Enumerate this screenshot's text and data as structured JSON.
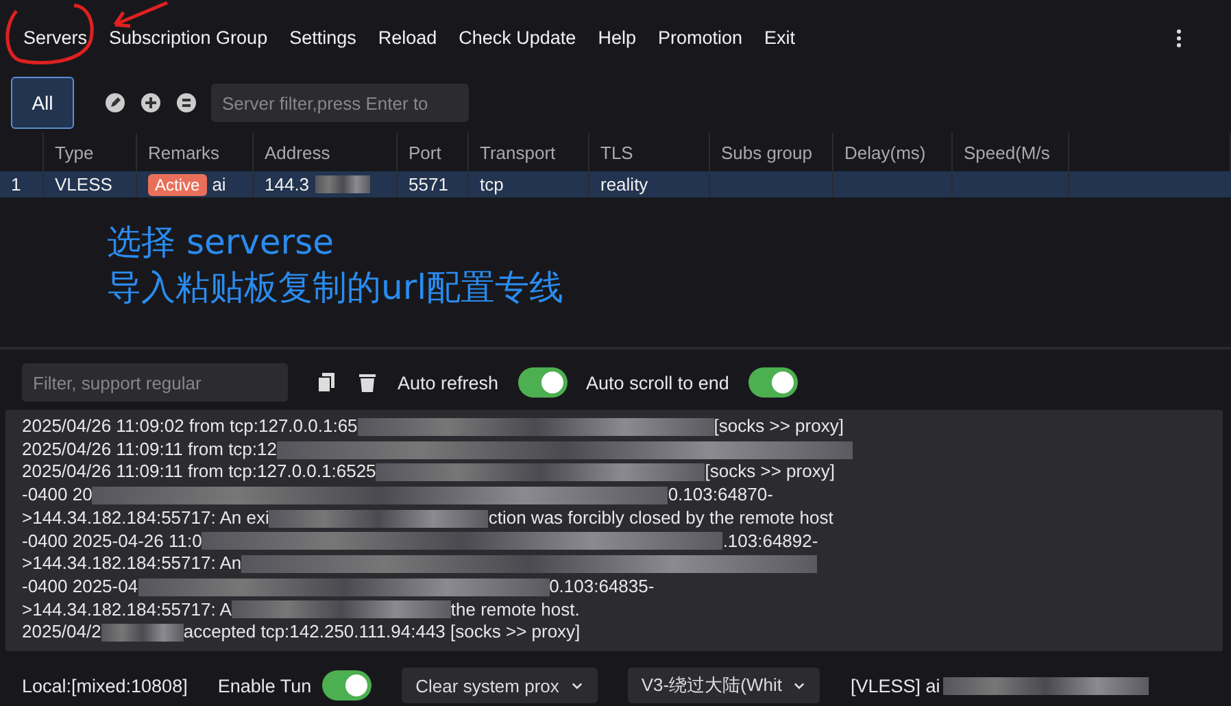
{
  "menu": [
    "Servers",
    "Subscription Group",
    "Settings",
    "Reload",
    "Check Update",
    "Help",
    "Promotion",
    "Exit"
  ],
  "group_tabs": [
    {
      "label": "All",
      "selected": true
    }
  ],
  "server_filter": {
    "placeholder": "Server filter,press Enter to "
  },
  "table": {
    "columns": [
      "",
      "Type",
      "Remarks",
      "Address",
      "Port",
      "Transport",
      "TLS",
      "Subs group",
      "Delay(ms)",
      "Speed(M/s"
    ],
    "rows": [
      {
        "selected": true,
        "cells": [
          "1",
          "VLESS",
          "ai",
          "144.3",
          "5571",
          "tcp",
          "reality",
          "",
          "",
          ""
        ],
        "badge": "Active"
      }
    ]
  },
  "log_filter": {
    "placeholder": "Filter, support regular"
  },
  "toggles": [
    {
      "label": "Auto refresh",
      "on": true
    },
    {
      "label": "Auto scroll to end",
      "on": true
    }
  ],
  "log_lines": [
    {
      "start": "2025/04/26 11:09:02 from tcp:127.0.0.1:65",
      "end": "[socks >> proxy]"
    },
    {
      "start": "2025/04/26 11:09:11 from tcp:12"
    },
    {
      "start": "2025/04/26 11:09:11 from tcp:127.0.0.1:6525",
      "end": "[socks >> proxy]"
    },
    {
      "start": "-0400 20",
      "end": "0.103:64870-"
    },
    {
      "start": ">144.34.182.184:55717: An exi",
      "end": "ction was forcibly closed by the remote host"
    },
    {
      "start": "-0400 2025-04-26 11:0",
      "end": ".103:64892-"
    },
    {
      "start": ">144.34.182.184:55717: An"
    },
    {
      "start": "-0400 2025-04",
      "end": "0.103:64835-"
    },
    {
      "start": ">144.34.182.184:55717: A",
      "end": "the remote host."
    },
    {
      "start": "2025/04/2",
      "end": "accepted tcp:142.250.111.94:443 [socks >> proxy]"
    }
  ],
  "status": {
    "local": "Local:[mixed:10808]",
    "tun": {
      "label": "Enable Tun",
      "on": true
    },
    "selects": [
      "Clear system prox",
      "V3-绕过大陆(Whit"
    ],
    "current": "[VLESS] ai"
  },
  "annotations": [
    "选择 serverse",
    "导入粘贴板复制的url配置专线"
  ]
}
